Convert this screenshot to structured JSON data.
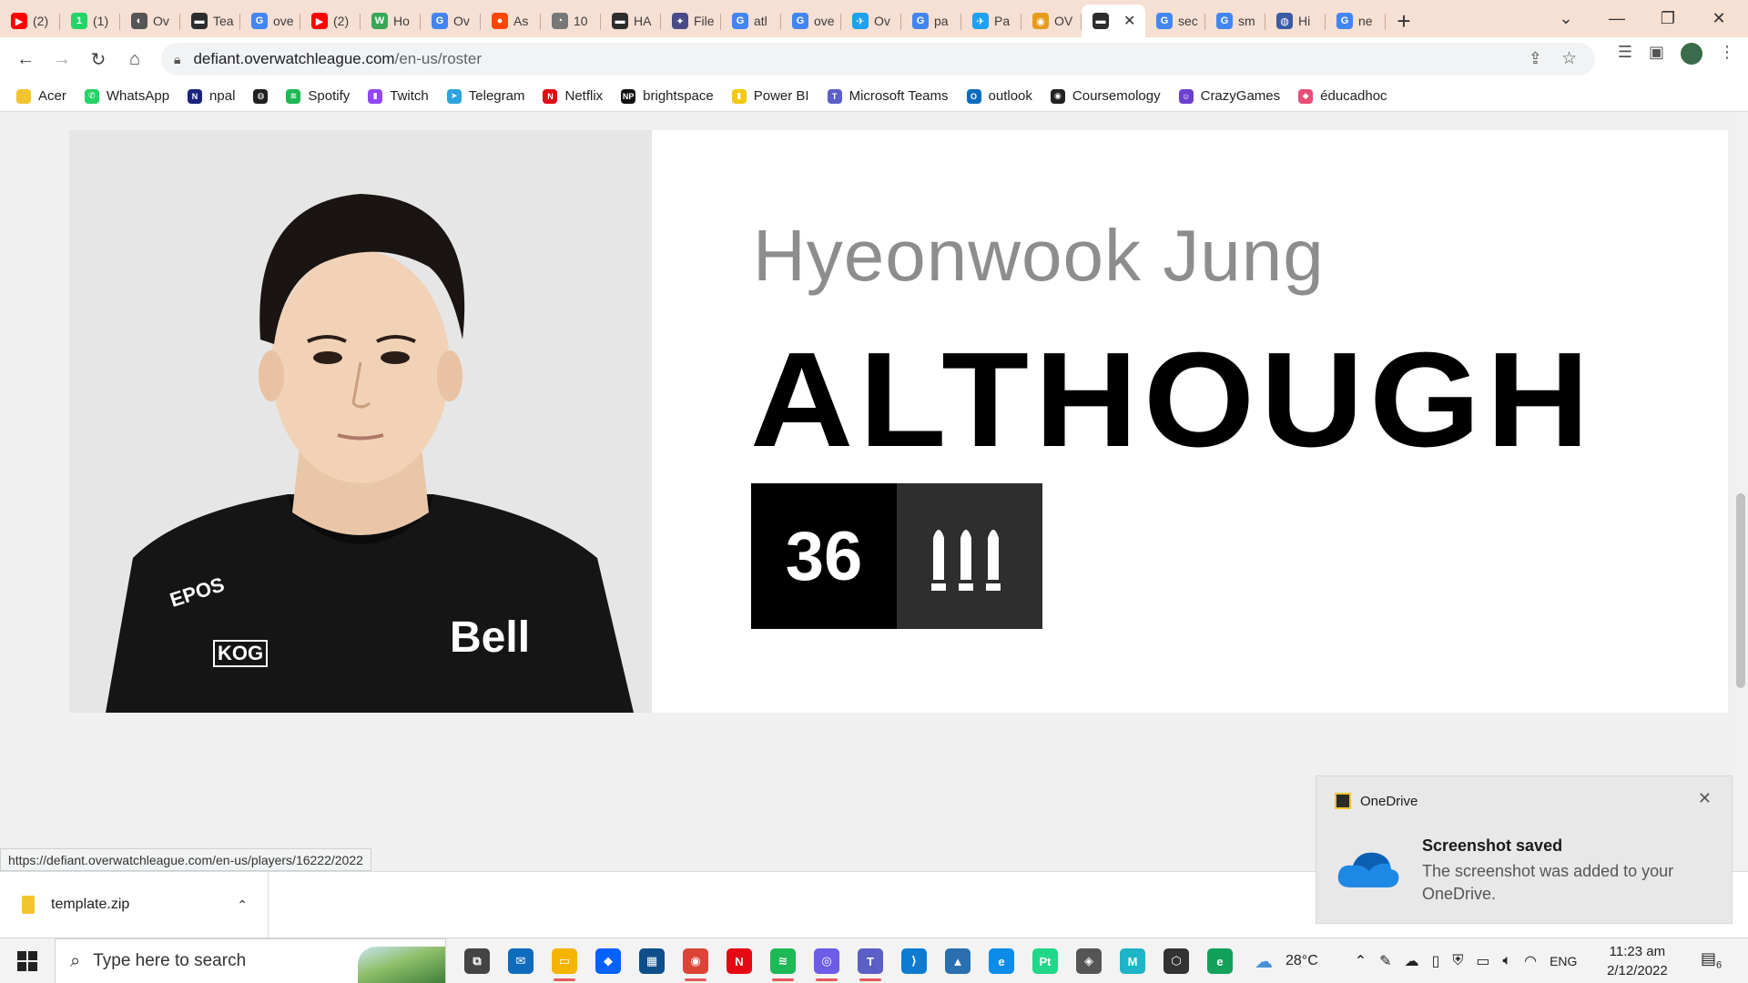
{
  "browser": {
    "tabs": [
      {
        "label": "(2)",
        "color": "#ff0000",
        "glyph": "▶"
      },
      {
        "label": "(1)",
        "color": "#25d366",
        "glyph": "1"
      },
      {
        "label": "Ov",
        "color": "#555555",
        "glyph": "◐"
      },
      {
        "label": "Tea",
        "color": "#2d2d2d",
        "glyph": "▬"
      },
      {
        "label": "ove",
        "color": "#4285f4",
        "glyph": "G"
      },
      {
        "label": "(2)",
        "color": "#ff0000",
        "glyph": "▶"
      },
      {
        "label": "Ho",
        "color": "#3aa757",
        "glyph": "W"
      },
      {
        "label": "Ov",
        "color": "#4285f4",
        "glyph": "G"
      },
      {
        "label": "As",
        "color": "#ff4500",
        "glyph": "●"
      },
      {
        "label": "10",
        "color": "#777777",
        "glyph": "◔"
      },
      {
        "label": "HA",
        "color": "#2d2d2d",
        "glyph": "▬"
      },
      {
        "label": "File",
        "color": "#4a4a8a",
        "glyph": "✦"
      },
      {
        "label": "atl",
        "color": "#4285f4",
        "glyph": "G"
      },
      {
        "label": "ove",
        "color": "#4285f4",
        "glyph": "G"
      },
      {
        "label": "Ov",
        "color": "#1da1f2",
        "glyph": "✈"
      },
      {
        "label": "pa",
        "color": "#4285f4",
        "glyph": "G"
      },
      {
        "label": "Pa",
        "color": "#1da1f2",
        "glyph": "✈"
      },
      {
        "label": "OV",
        "color": "#e89a1c",
        "glyph": "◉"
      },
      {
        "label": "",
        "color": "#2d2d2d",
        "glyph": "▬",
        "active": true
      },
      {
        "label": "sec",
        "color": "#4285f4",
        "glyph": "G"
      },
      {
        "label": "sm",
        "color": "#4285f4",
        "glyph": "G"
      },
      {
        "label": "Hi",
        "color": "#3b5ba5",
        "glyph": "◍"
      },
      {
        "label": "ne",
        "color": "#4285f4",
        "glyph": "G"
      }
    ],
    "url_domain": "defiant.overwatchleague.com",
    "url_path": "/en-us/roster",
    "bookmarks": [
      {
        "label": "Acer",
        "color": "#f4c430",
        "glyph": ""
      },
      {
        "label": "WhatsApp",
        "color": "#25d366",
        "glyph": "✆"
      },
      {
        "label": "npal",
        "color": "#1a237e",
        "glyph": "N"
      },
      {
        "label": "",
        "color": "#222222",
        "glyph": "◍"
      },
      {
        "label": "Spotify",
        "color": "#1db954",
        "glyph": "≋"
      },
      {
        "label": "Twitch",
        "color": "#9146ff",
        "glyph": "▮"
      },
      {
        "label": "Telegram",
        "color": "#2aa3e0",
        "glyph": "➤"
      },
      {
        "label": "Netflix",
        "color": "#e50914",
        "glyph": "N"
      },
      {
        "label": "brightspace",
        "color": "#111111",
        "glyph": "NP"
      },
      {
        "label": "Power BI",
        "color": "#f2c811",
        "glyph": "▮"
      },
      {
        "label": "Microsoft Teams",
        "color": "#5b5fc7",
        "glyph": "T"
      },
      {
        "label": "outlook",
        "color": "#0f6cbd",
        "glyph": "O"
      },
      {
        "label": "Coursemology",
        "color": "#222222",
        "glyph": "◉"
      },
      {
        "label": "CrazyGames",
        "color": "#6c3fd1",
        "glyph": "☺"
      },
      {
        "label": "éducadhoc",
        "color": "#e94e77",
        "glyph": "◆"
      }
    ],
    "status_url": "https://defiant.overwatchleague.com/en-us/players/16222/2022"
  },
  "player": {
    "real_name": "Hyeonwook Jung",
    "gamer_tag": "ALTHOUGH",
    "number": "36",
    "role_icon": "damage-role-icon",
    "jersey_sponsors": [
      "EPOS",
      "KOG",
      "Bell"
    ]
  },
  "downloads": {
    "file_name": "template.zip"
  },
  "toast": {
    "app": "OneDrive",
    "title": "Screenshot saved",
    "body": "The screenshot was added to your OneDrive."
  },
  "taskbar": {
    "search_placeholder": "Type here to search",
    "temperature": "28°C",
    "language": "ENG",
    "time": "11:23 am",
    "date": "2/12/2022",
    "notification_count": "6",
    "apps": [
      {
        "name": "task-view",
        "color": "#444444",
        "glyph": "⧉",
        "running": false
      },
      {
        "name": "mail",
        "color": "#0f6cbd",
        "glyph": "✉",
        "running": false
      },
      {
        "name": "file-explorer",
        "color": "#f4b400",
        "glyph": "▭",
        "running": true
      },
      {
        "name": "dropbox",
        "color": "#0061ff",
        "glyph": "◆",
        "running": false
      },
      {
        "name": "app-blue",
        "color": "#0e4e8a",
        "glyph": "▦",
        "running": false
      },
      {
        "name": "chrome",
        "color": "#db4437",
        "glyph": "◉",
        "running": true
      },
      {
        "name": "netflix",
        "color": "#e50914",
        "glyph": "N",
        "running": false
      },
      {
        "name": "spotify",
        "color": "#1db954",
        "glyph": "≋",
        "running": true
      },
      {
        "name": "messenger",
        "color": "#6d5ce6",
        "glyph": "◎",
        "running": true
      },
      {
        "name": "teams",
        "color": "#5b5fc7",
        "glyph": "T",
        "running": true
      },
      {
        "name": "vscode",
        "color": "#0e7bd1",
        "glyph": "⟩",
        "running": false
      },
      {
        "name": "photos",
        "color": "#2a6fb0",
        "glyph": "▲",
        "running": false
      },
      {
        "name": "edge",
        "color": "#0c8ce9",
        "glyph": "e",
        "running": false
      },
      {
        "name": "pycharm",
        "color": "#21d789",
        "glyph": "Pt",
        "running": false
      },
      {
        "name": "unity",
        "color": "#555555",
        "glyph": "◈",
        "running": false
      },
      {
        "name": "maya",
        "color": "#1fb4c8",
        "glyph": "M",
        "running": false
      },
      {
        "name": "unity-hub",
        "color": "#333333",
        "glyph": "⬡",
        "running": false
      },
      {
        "name": "edge-dev",
        "color": "#12a05a",
        "glyph": "e",
        "running": false
      }
    ]
  }
}
